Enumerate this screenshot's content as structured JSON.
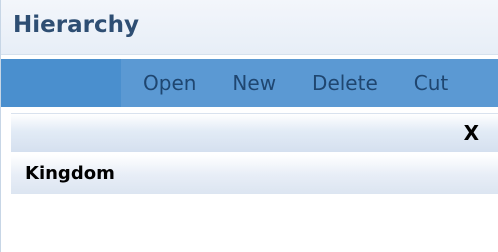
{
  "panel": {
    "title": "Hierarchy"
  },
  "toolbar": {
    "buttons": [
      {
        "label": "Open"
      },
      {
        "label": "New"
      },
      {
        "label": "Delete"
      },
      {
        "label": "Cut"
      }
    ]
  },
  "header_row": {
    "close_label": "X"
  },
  "tree": {
    "items": [
      {
        "label": "Kingdom"
      }
    ]
  },
  "colors": {
    "toolbar": "#4a8fce",
    "title": "#2e4e73"
  }
}
